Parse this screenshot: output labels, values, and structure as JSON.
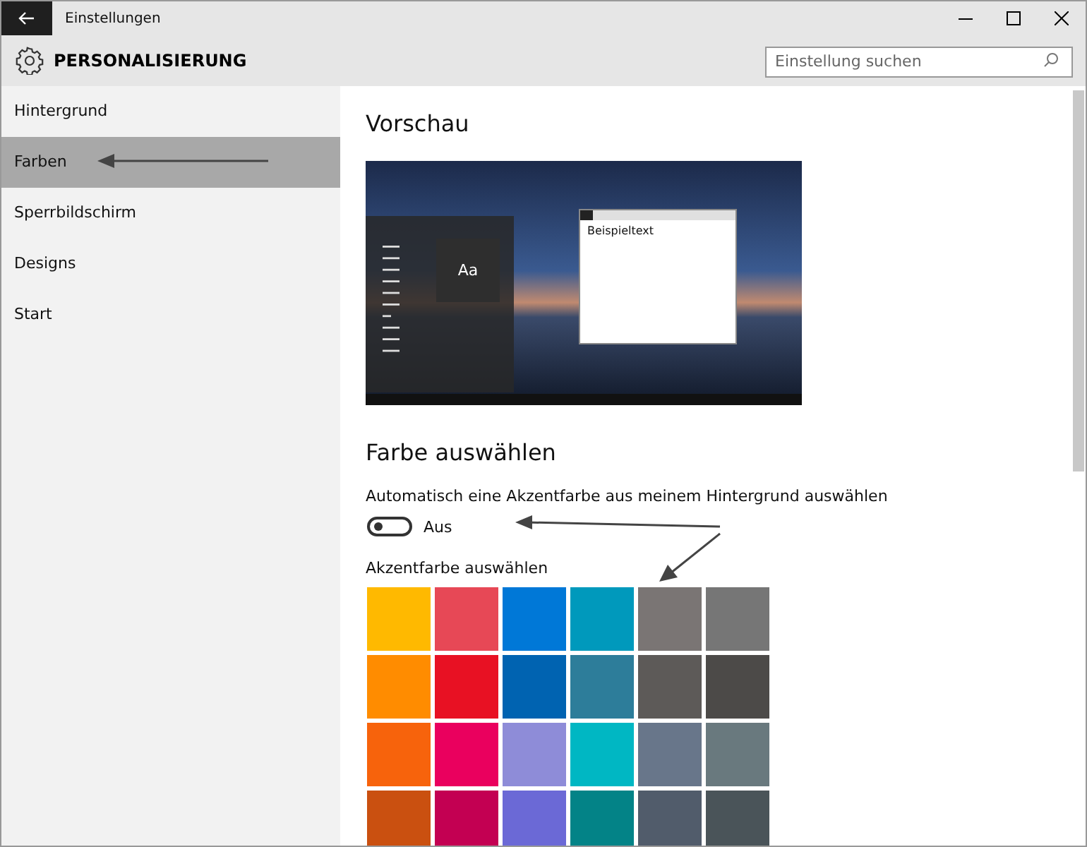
{
  "window": {
    "title": "Einstellungen"
  },
  "header": {
    "title": "PERSONALISIERUNG",
    "search": {
      "placeholder": "Einstellung suchen"
    }
  },
  "sidebar": {
    "items": [
      {
        "label": "Hintergrund",
        "selected": false
      },
      {
        "label": "Farben",
        "selected": true
      },
      {
        "label": "Sperrbildschirm",
        "selected": false
      },
      {
        "label": "Designs",
        "selected": false
      },
      {
        "label": "Start",
        "selected": false
      }
    ]
  },
  "preview": {
    "heading": "Vorschau",
    "tile_label": "Aa",
    "sample_text": "Beispieltext"
  },
  "color_section": {
    "heading": "Farbe auswählen",
    "auto_label": "Automatisch eine Akzentfarbe aus meinem Hintergrund auswählen",
    "toggle": {
      "on": false,
      "label": "Aus"
    },
    "accent_label": "Akzentfarbe auswählen",
    "swatches": [
      {
        "color": "#ffb900"
      },
      {
        "color": "#e74856"
      },
      {
        "color": "#0078d7"
      },
      {
        "color": "#0099bc"
      },
      {
        "color": "#7a7574"
      },
      {
        "color": "#767676"
      },
      {
        "color": "#ff8c00"
      },
      {
        "color": "#e81123"
      },
      {
        "color": "#0063b1"
      },
      {
        "color": "#2d7d9a"
      },
      {
        "color": "#5d5a58"
      },
      {
        "color": "#4c4a48"
      },
      {
        "color": "#f7630c"
      },
      {
        "color": "#ea005e"
      },
      {
        "color": "#8e8cd8"
      },
      {
        "color": "#00b7c3"
      },
      {
        "color": "#68768a"
      },
      {
        "color": "#69797e"
      },
      {
        "color": "#ca5010"
      },
      {
        "color": "#c30052"
      },
      {
        "color": "#6b69d6"
      },
      {
        "color": "#038387"
      },
      {
        "color": "#515c6b"
      },
      {
        "color": "#4a5459"
      }
    ]
  }
}
